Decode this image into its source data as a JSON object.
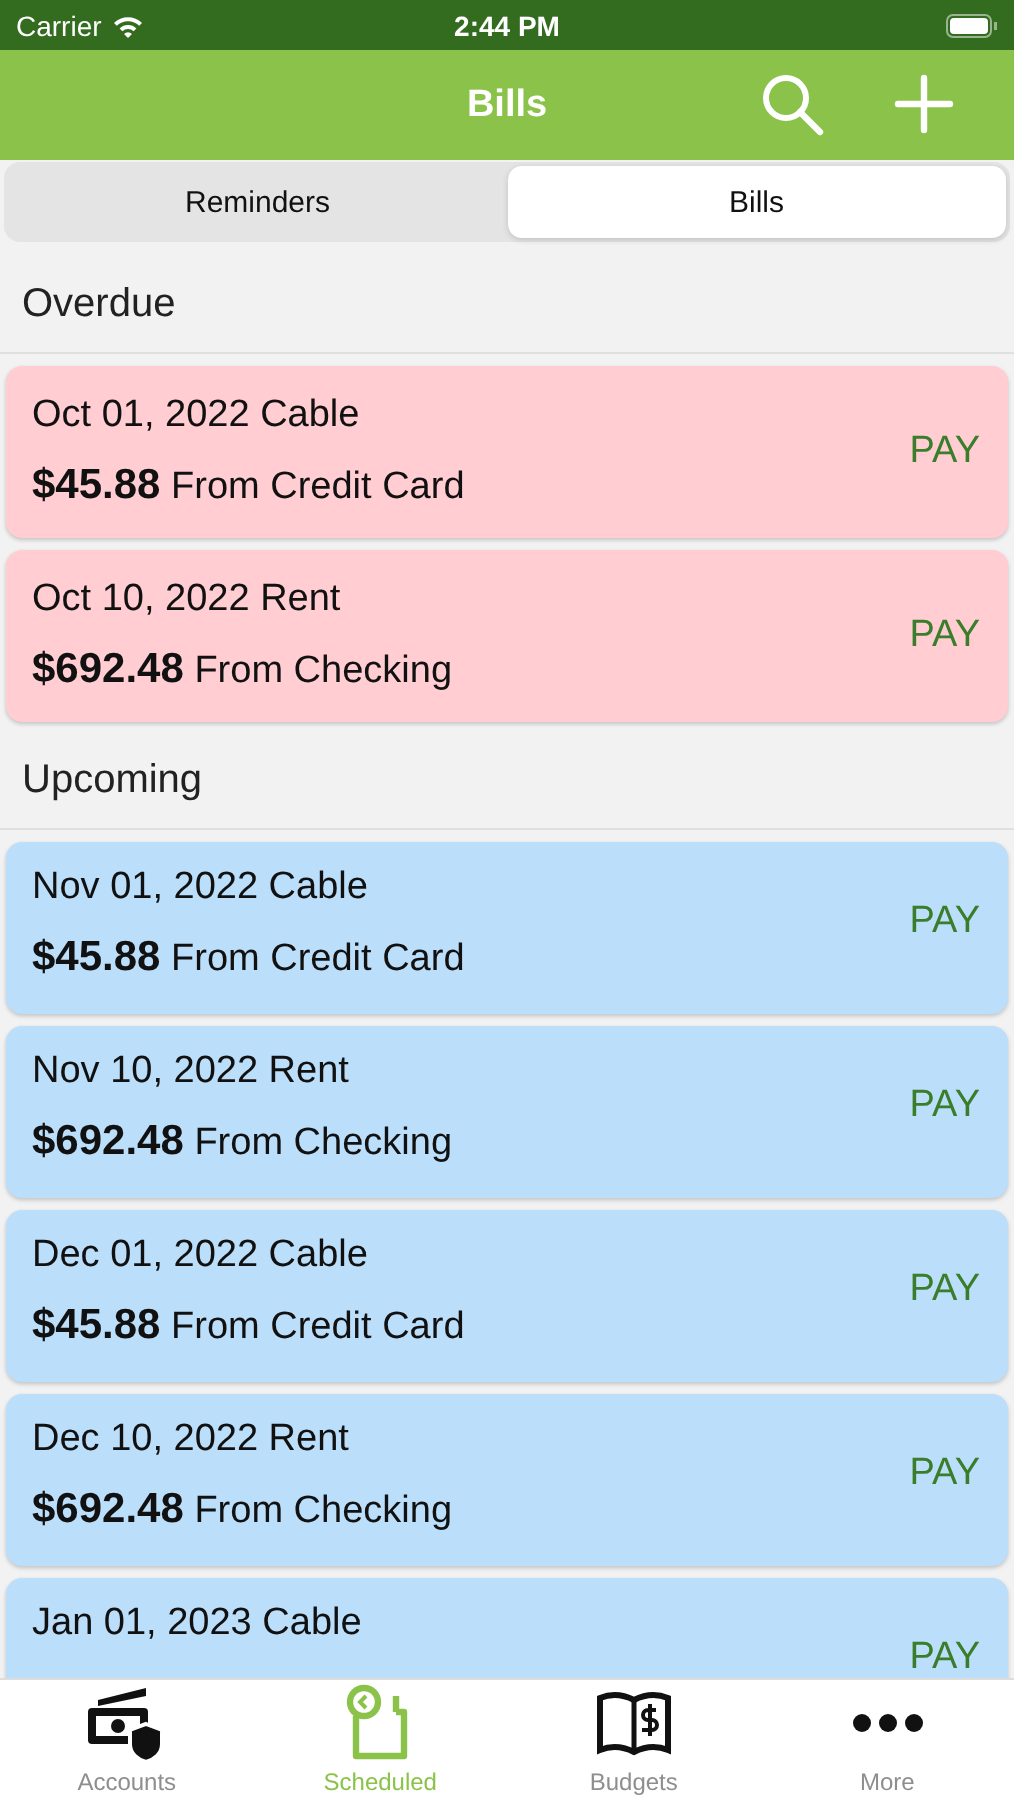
{
  "status_bar": {
    "carrier": "Carrier",
    "time": "2:44 PM"
  },
  "nav": {
    "title": "Bills"
  },
  "segments": [
    {
      "label": "Reminders",
      "selected": false
    },
    {
      "label": "Bills",
      "selected": true
    }
  ],
  "sections": [
    {
      "title": "Overdue",
      "kind": "overdue",
      "bills": [
        {
          "title": "Oct 01, 2022 Cable",
          "amount": "$45.88",
          "source": "From Credit Card",
          "action": "PAY"
        },
        {
          "title": "Oct 10, 2022 Rent",
          "amount": "$692.48",
          "source": "From Checking",
          "action": "PAY"
        }
      ]
    },
    {
      "title": "Upcoming",
      "kind": "upcoming",
      "bills": [
        {
          "title": "Nov 01, 2022 Cable",
          "amount": "$45.88",
          "source": "From Credit Card",
          "action": "PAY"
        },
        {
          "title": "Nov 10, 2022 Rent",
          "amount": "$692.48",
          "source": "From Checking",
          "action": "PAY"
        },
        {
          "title": "Dec 01, 2022 Cable",
          "amount": "$45.88",
          "source": "From Credit Card",
          "action": "PAY"
        },
        {
          "title": "Dec 10, 2022 Rent",
          "amount": "$692.48",
          "source": "From Checking",
          "action": "PAY"
        },
        {
          "title": "Jan 01, 2023 Cable",
          "action": "PAY"
        }
      ]
    }
  ],
  "tab_bar": [
    {
      "label": "Accounts",
      "kind": "accounts",
      "selected": false
    },
    {
      "label": "Scheduled",
      "kind": "scheduled",
      "selected": true
    },
    {
      "label": "Budgets",
      "kind": "budgets",
      "selected": false
    },
    {
      "label": "More",
      "kind": "more",
      "selected": false
    }
  ]
}
